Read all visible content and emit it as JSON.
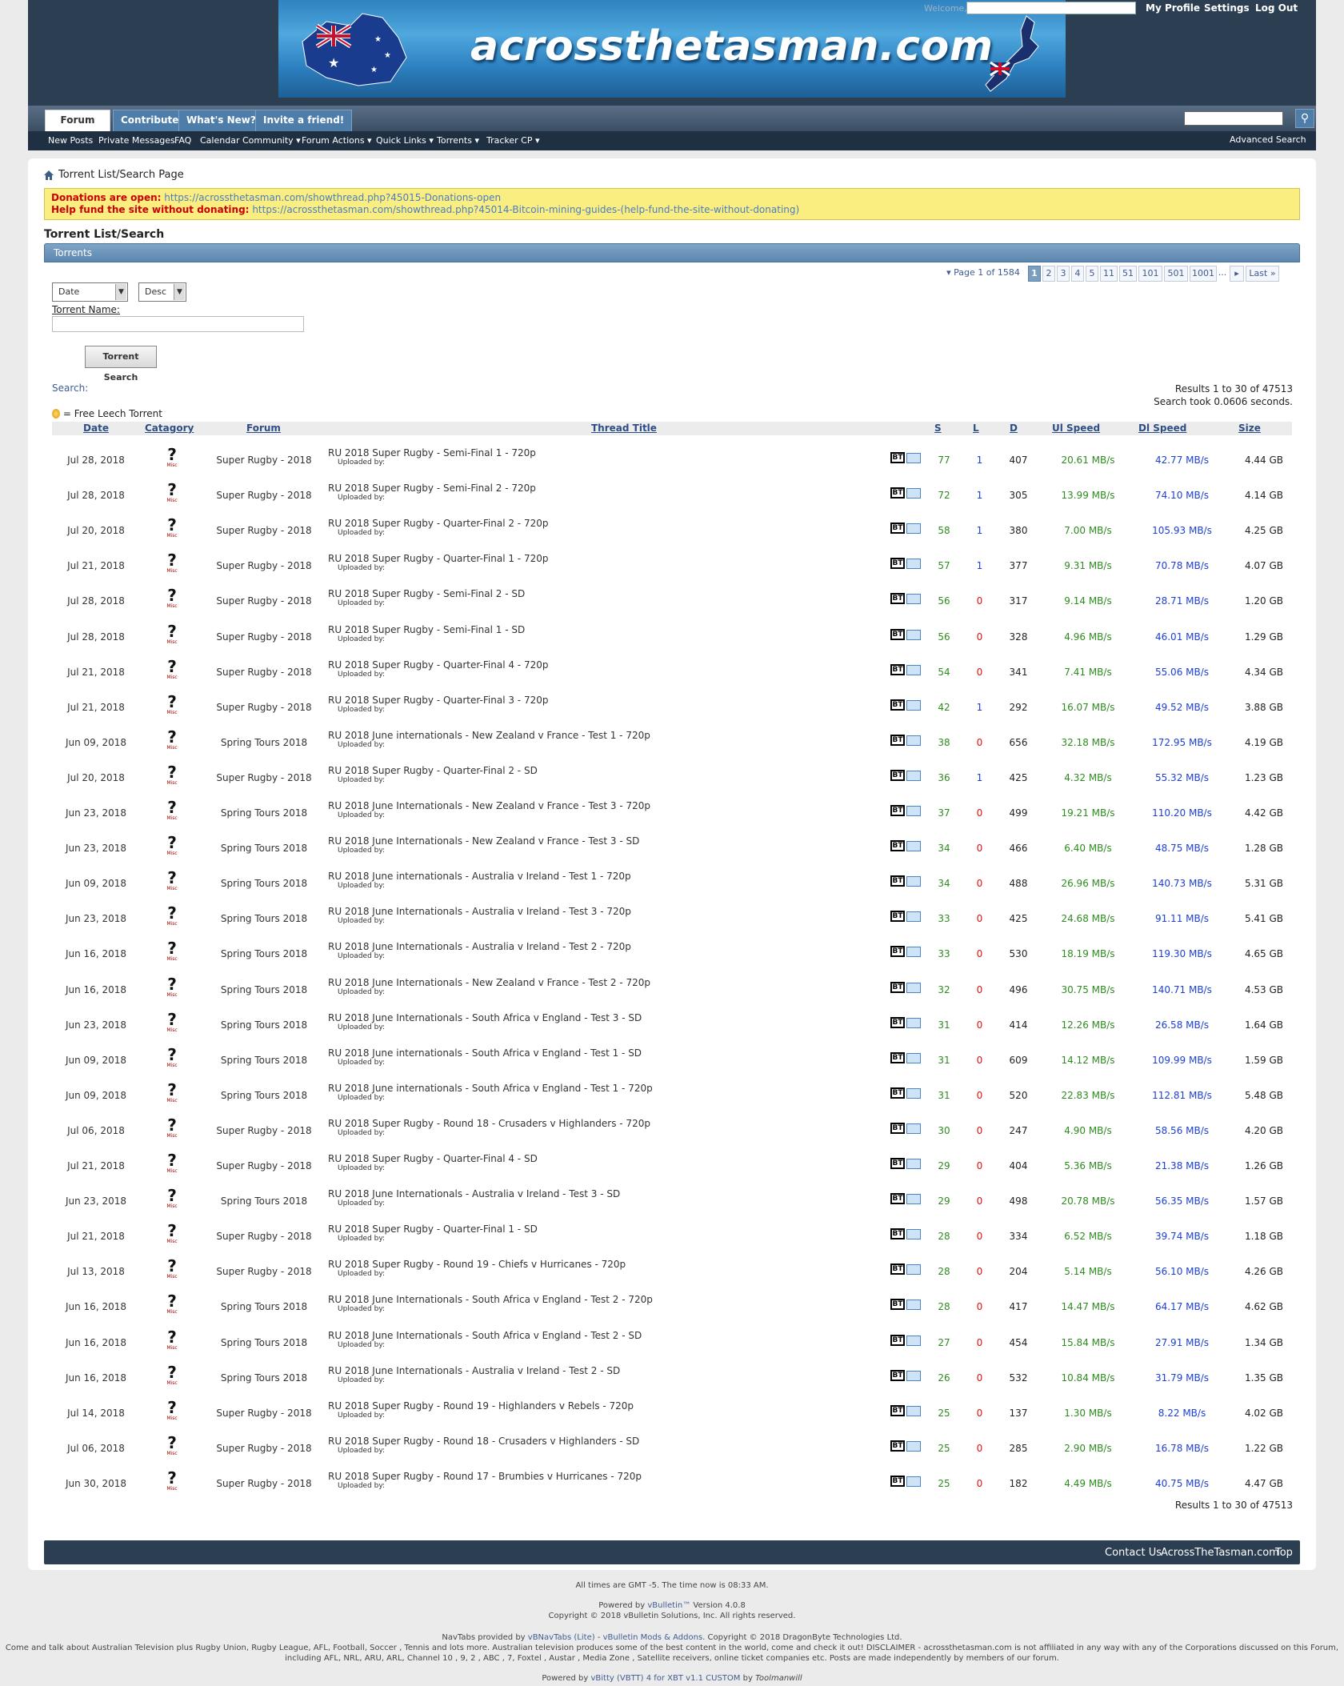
{
  "header": {
    "welcome": "Welcome,",
    "links": [
      "My Profile",
      "Settings",
      "Log Out"
    ],
    "banner_title": "acrossthetasman.com"
  },
  "nav": {
    "tabs": [
      "Forum",
      "Contribute",
      "What's New?",
      "Invite a friend!"
    ],
    "subnav": [
      "New Posts",
      "Private Messages",
      "FAQ",
      "Calendar",
      "Community ▾",
      "Forum Actions ▾",
      "Quick Links ▾",
      "Torrents ▾",
      "Tracker CP ▾"
    ],
    "advanced_search": "Advanced Search"
  },
  "breadcrumb": "Torrent List/Search Page",
  "notice": {
    "line1_label": "Donations are open:",
    "line1_link": "https://acrossthetasman.com/showthread.php?45015-Donations-open",
    "line2_label": "Help fund the site without donating:",
    "line2_link": "https://acrossthetasman.com/showthread.php?45014-Bitcoin-mining-guides-(help-fund-the-site-without-donating)"
  },
  "page_title": "Torrent List/Search",
  "section_title": "Torrents",
  "pagination": {
    "label": "▾ Page 1 of 1584",
    "pages": [
      "1",
      "2",
      "3",
      "4",
      "5",
      "11",
      "51",
      "101",
      "501",
      "1001"
    ],
    "ellipsis": "...",
    "next": "▸",
    "last": "Last »"
  },
  "filters": {
    "sort_by": "Date",
    "order": "Desc",
    "torrent_name_label": "Torrent Name:",
    "torrent_name_value": "",
    "search_button": "Torrent Search",
    "search_label": "Search:"
  },
  "results": {
    "summary": "Results 1 to 30 of 47513",
    "timing": "Search took 0.0606 seconds.",
    "free_leech_legend": "= Free Leech Torrent"
  },
  "columns": [
    "Date",
    "Catagory",
    "Forum",
    "Thread Title",
    "S",
    "L",
    "D",
    "Ul Speed",
    "Dl Speed",
    "Size"
  ],
  "category_label": "Misc",
  "uploaded_label": "Uploaded by:",
  "bt_icon_label": "BT",
  "rows": [
    {
      "date": "Jul 28, 2018",
      "forum": "Super Rugby - 2018",
      "title": "RU 2018 Super Rugby - Semi-Final 1 - 720p",
      "s": "77",
      "l": "1",
      "d": "407",
      "ul": "20.61 MB/s",
      "dl": "42.77 MB/s",
      "size": "4.44 GB"
    },
    {
      "date": "Jul 28, 2018",
      "forum": "Super Rugby - 2018",
      "title": "RU 2018 Super Rugby - Semi-Final 2 - 720p",
      "s": "72",
      "l": "1",
      "d": "305",
      "ul": "13.99 MB/s",
      "dl": "74.10 MB/s",
      "size": "4.14 GB"
    },
    {
      "date": "Jul 20, 2018",
      "forum": "Super Rugby - 2018",
      "title": "RU 2018 Super Rugby - Quarter-Final 2 - 720p",
      "s": "58",
      "l": "1",
      "d": "380",
      "ul": "7.00 MB/s",
      "dl": "105.93 MB/s",
      "size": "4.25 GB"
    },
    {
      "date": "Jul 21, 2018",
      "forum": "Super Rugby - 2018",
      "title": "RU 2018 Super Rugby - Quarter-Final 1 - 720p",
      "s": "57",
      "l": "1",
      "d": "377",
      "ul": "9.31 MB/s",
      "dl": "70.78 MB/s",
      "size": "4.07 GB"
    },
    {
      "date": "Jul 28, 2018",
      "forum": "Super Rugby - 2018",
      "title": "RU 2018 Super Rugby - Semi-Final 2 - SD",
      "s": "56",
      "l": "0",
      "d": "317",
      "ul": "9.14 MB/s",
      "dl": "28.71 MB/s",
      "size": "1.20 GB"
    },
    {
      "date": "Jul 28, 2018",
      "forum": "Super Rugby - 2018",
      "title": "RU 2018 Super Rugby - Semi-Final 1 - SD",
      "s": "56",
      "l": "0",
      "d": "328",
      "ul": "4.96 MB/s",
      "dl": "46.01 MB/s",
      "size": "1.29 GB"
    },
    {
      "date": "Jul 21, 2018",
      "forum": "Super Rugby - 2018",
      "title": "RU 2018 Super Rugby - Quarter-Final 4 - 720p",
      "s": "54",
      "l": "0",
      "d": "341",
      "ul": "7.41 MB/s",
      "dl": "55.06 MB/s",
      "size": "4.34 GB"
    },
    {
      "date": "Jul 21, 2018",
      "forum": "Super Rugby - 2018",
      "title": "RU 2018 Super Rugby - Quarter-Final 3 - 720p",
      "s": "42",
      "l": "1",
      "d": "292",
      "ul": "16.07 MB/s",
      "dl": "49.52 MB/s",
      "size": "3.88 GB"
    },
    {
      "date": "Jun 09, 2018",
      "forum": "Spring Tours 2018",
      "title": "RU 2018 June internationals - New Zealand v France - Test 1 - 720p",
      "s": "38",
      "l": "0",
      "d": "656",
      "ul": "32.18 MB/s",
      "dl": "172.95 MB/s",
      "size": "4.19 GB"
    },
    {
      "date": "Jul 20, 2018",
      "forum": "Super Rugby - 2018",
      "title": "RU 2018 Super Rugby - Quarter-Final 2 - SD",
      "s": "36",
      "l": "1",
      "d": "425",
      "ul": "4.32 MB/s",
      "dl": "55.32 MB/s",
      "size": "1.23 GB"
    },
    {
      "date": "Jun 23, 2018",
      "forum": "Spring Tours 2018",
      "title": "RU 2018 June Internationals - New Zealand v France - Test 3 - 720p",
      "s": "37",
      "l": "0",
      "d": "499",
      "ul": "19.21 MB/s",
      "dl": "110.20 MB/s",
      "size": "4.42 GB"
    },
    {
      "date": "Jun 23, 2018",
      "forum": "Spring Tours 2018",
      "title": "RU 2018 June Internationals - New Zealand v France - Test 3 - SD",
      "s": "34",
      "l": "0",
      "d": "466",
      "ul": "6.40 MB/s",
      "dl": "48.75 MB/s",
      "size": "1.28 GB"
    },
    {
      "date": "Jun 09, 2018",
      "forum": "Spring Tours 2018",
      "title": "RU 2018 June internationals - Australia v Ireland - Test 1 - 720p",
      "s": "34",
      "l": "0",
      "d": "488",
      "ul": "26.96 MB/s",
      "dl": "140.73 MB/s",
      "size": "5.31 GB"
    },
    {
      "date": "Jun 23, 2018",
      "forum": "Spring Tours 2018",
      "title": "RU 2018 June Internationals - Australia v Ireland - Test 3 - 720p",
      "s": "33",
      "l": "0",
      "d": "425",
      "ul": "24.68 MB/s",
      "dl": "91.11 MB/s",
      "size": "5.41 GB"
    },
    {
      "date": "Jun 16, 2018",
      "forum": "Spring Tours 2018",
      "title": "RU 2018 June Internationals - Australia v Ireland - Test 2 - 720p",
      "s": "33",
      "l": "0",
      "d": "530",
      "ul": "18.19 MB/s",
      "dl": "119.30 MB/s",
      "size": "4.65 GB"
    },
    {
      "date": "Jun 16, 2018",
      "forum": "Spring Tours 2018",
      "title": "RU 2018 June Internationals - New Zealand v France - Test 2 - 720p",
      "s": "32",
      "l": "0",
      "d": "496",
      "ul": "30.75 MB/s",
      "dl": "140.71 MB/s",
      "size": "4.53 GB"
    },
    {
      "date": "Jun 23, 2018",
      "forum": "Spring Tours 2018",
      "title": "RU 2018 June Internationals - South Africa v England - Test 3 - SD",
      "s": "31",
      "l": "0",
      "d": "414",
      "ul": "12.26 MB/s",
      "dl": "26.58 MB/s",
      "size": "1.64 GB"
    },
    {
      "date": "Jun 09, 2018",
      "forum": "Spring Tours 2018",
      "title": "RU 2018 June internationals - South Africa v England - Test 1 - SD",
      "s": "31",
      "l": "0",
      "d": "609",
      "ul": "14.12 MB/s",
      "dl": "109.99 MB/s",
      "size": "1.59 GB"
    },
    {
      "date": "Jun 09, 2018",
      "forum": "Spring Tours 2018",
      "title": "RU 2018 June internationals - South Africa v England - Test 1 - 720p",
      "s": "31",
      "l": "0",
      "d": "520",
      "ul": "22.83 MB/s",
      "dl": "112.81 MB/s",
      "size": "5.48 GB"
    },
    {
      "date": "Jul 06, 2018",
      "forum": "Super Rugby - 2018",
      "title": "RU 2018 Super Rugby - Round 18 - Crusaders v Highlanders - 720p",
      "s": "30",
      "l": "0",
      "d": "247",
      "ul": "4.90 MB/s",
      "dl": "58.56 MB/s",
      "size": "4.20 GB"
    },
    {
      "date": "Jul 21, 2018",
      "forum": "Super Rugby - 2018",
      "title": "RU 2018 Super Rugby - Quarter-Final 4 - SD",
      "s": "29",
      "l": "0",
      "d": "404",
      "ul": "5.36 MB/s",
      "dl": "21.38 MB/s",
      "size": "1.26 GB"
    },
    {
      "date": "Jun 23, 2018",
      "forum": "Spring Tours 2018",
      "title": "RU 2018 June Internationals - Australia v Ireland - Test 3 - SD",
      "s": "29",
      "l": "0",
      "d": "498",
      "ul": "20.78 MB/s",
      "dl": "56.35 MB/s",
      "size": "1.57 GB"
    },
    {
      "date": "Jul 21, 2018",
      "forum": "Super Rugby - 2018",
      "title": "RU 2018 Super Rugby - Quarter-Final 1 - SD",
      "s": "28",
      "l": "0",
      "d": "334",
      "ul": "6.52 MB/s",
      "dl": "39.74 MB/s",
      "size": "1.18 GB"
    },
    {
      "date": "Jul 13, 2018",
      "forum": "Super Rugby - 2018",
      "title": "RU 2018 Super Rugby - Round 19 - Chiefs v Hurricanes - 720p",
      "s": "28",
      "l": "0",
      "d": "204",
      "ul": "5.14 MB/s",
      "dl": "56.10 MB/s",
      "size": "4.26 GB"
    },
    {
      "date": "Jun 16, 2018",
      "forum": "Spring Tours 2018",
      "title": "RU 2018 June Internationals - South Africa v England - Test 2 - 720p",
      "s": "28",
      "l": "0",
      "d": "417",
      "ul": "14.47 MB/s",
      "dl": "64.17 MB/s",
      "size": "4.62 GB"
    },
    {
      "date": "Jun 16, 2018",
      "forum": "Spring Tours 2018",
      "title": "RU 2018 June Internationals - South Africa v England - Test 2 - SD",
      "s": "27",
      "l": "0",
      "d": "454",
      "ul": "15.84 MB/s",
      "dl": "27.91 MB/s",
      "size": "1.34 GB"
    },
    {
      "date": "Jun 16, 2018",
      "forum": "Spring Tours 2018",
      "title": "RU 2018 June Internationals - Australia v Ireland - Test 2 - SD",
      "s": "26",
      "l": "0",
      "d": "532",
      "ul": "10.84 MB/s",
      "dl": "31.79 MB/s",
      "size": "1.35 GB"
    },
    {
      "date": "Jul 14, 2018",
      "forum": "Super Rugby - 2018",
      "title": "RU 2018 Super Rugby - Round 19 - Highlanders v Rebels - 720p",
      "s": "25",
      "l": "0",
      "d": "137",
      "ul": "1.30 MB/s",
      "dl": "8.22 MB/s",
      "size": "4.02 GB"
    },
    {
      "date": "Jul 06, 2018",
      "forum": "Super Rugby - 2018",
      "title": "RU 2018 Super Rugby - Round 18 - Crusaders v Highlanders - SD",
      "s": "25",
      "l": "0",
      "d": "285",
      "ul": "2.90 MB/s",
      "dl": "16.78 MB/s",
      "size": "1.22 GB"
    },
    {
      "date": "Jun 30, 2018",
      "forum": "Super Rugby - 2018",
      "title": "RU 2018 Super Rugby - Round 17 - Brumbies v Hurricanes - 720p",
      "s": "25",
      "l": "0",
      "d": "182",
      "ul": "4.49 MB/s",
      "dl": "40.75 MB/s",
      "size": "4.47 GB"
    }
  ],
  "footer": {
    "links": [
      "Contact Us",
      "AcrossTheTasman.com",
      "Top"
    ],
    "time": "All times are GMT -5. The time now is 08:33 AM.",
    "powered_prefix": "Powered by",
    "powered_link": "vBulletin™",
    "powered_suffix": "Version 4.0.8",
    "copyright": "Copyright © 2018 vBulletin Solutions, Inc. All rights reserved.",
    "navtabs_prefix": "NavTabs provided by",
    "navtabs_link1": "vBNavTabs (Lite)",
    "navtabs_sep": "-",
    "navtabs_link2": "vBulletin Mods & Addons.",
    "navtabs_suffix": "Copyright © 2018 DragonByte Technologies Ltd.",
    "disclaimer1": "Come and talk about Australian Television plus Rugby Union, Rugby League, AFL, Football, Soccer , Tennis and lots more. Australian television produces some of the best content in the world, come and check it out! DISCLAIMER - acrossthetasman.com is not affiliated in any way with any of the Corporations discussed on this Forum,",
    "disclaimer2": "including AFL, NRL, ARU, ARL, Channel 10 , 9, 2 , ABC , 7, Foxtel , Austar , Media Zone , Satellite receivers, online ticket companies etc. Posts are made independently by members of our forum.",
    "vbitty_prefix": "Powered by",
    "vbitty_link": "vBitty (VBTT) 4 for XBT v1.1 CUSTOM",
    "vbitty_by": "by",
    "vbitty_author": "Toolmanwill"
  },
  "colors": {
    "header_bg": "#2c3e52",
    "seeders_green": "#2e8b1f",
    "leechers_red": "#e01010",
    "leechers_blue": "#1d3fd4",
    "dl_blue": "#1d3fd4",
    "notice_bg": "#fbee80"
  }
}
